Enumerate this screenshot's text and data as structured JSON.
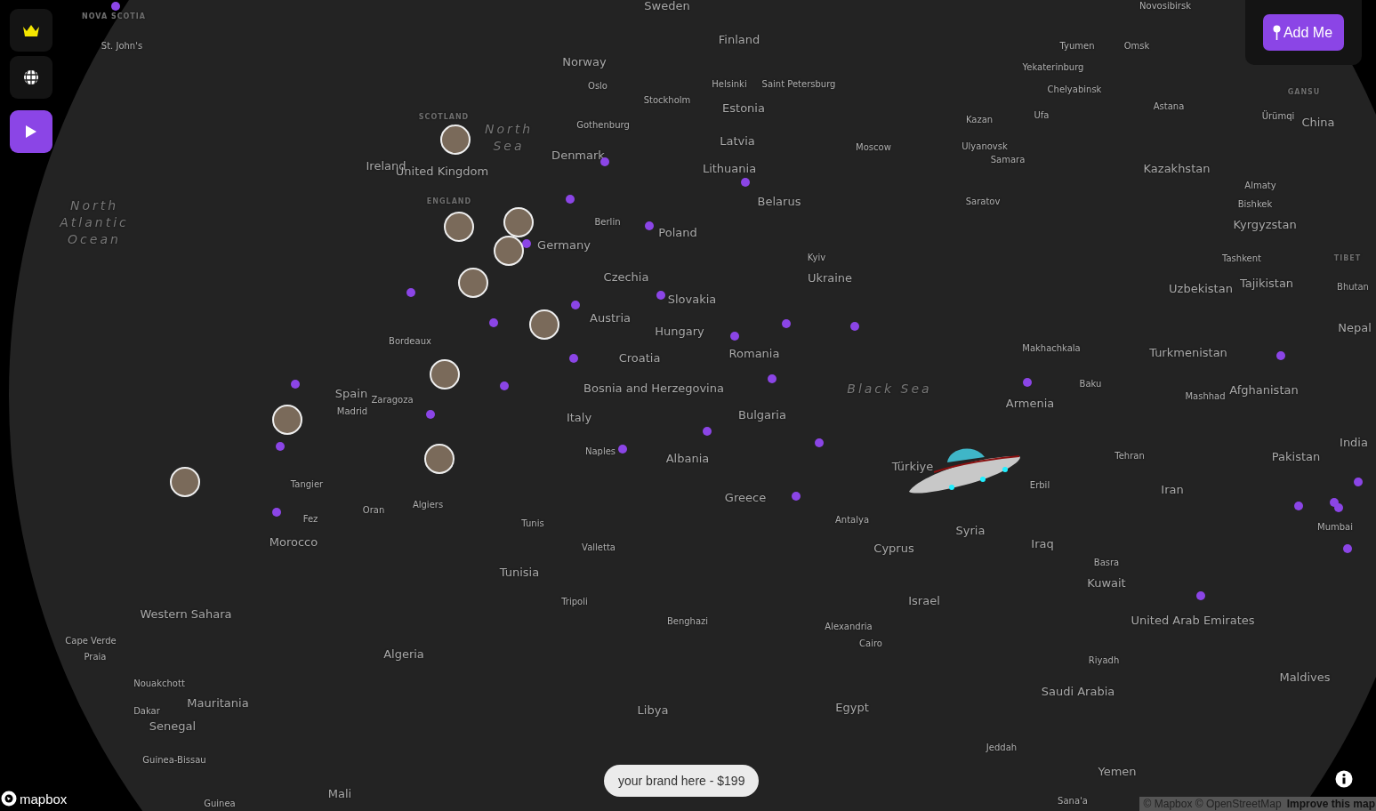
{
  "sidebar": {
    "buttons": [
      {
        "kind": "crown",
        "selected": false
      },
      {
        "kind": "globe",
        "selected": false
      },
      {
        "kind": "play",
        "selected": true
      }
    ]
  },
  "add_button": {
    "label": "Add Me"
  },
  "map_labels": [
    {
      "text": "Sweden",
      "kind": "country"
    },
    {
      "text": "Novosibirsk",
      "kind": "city"
    },
    {
      "text": "NOVA SCOTIA",
      "kind": "region"
    },
    {
      "text": "St. John's",
      "kind": "city"
    },
    {
      "text": "Finland",
      "kind": "country"
    },
    {
      "text": "Tyumen",
      "kind": "city"
    },
    {
      "text": "Omsk",
      "kind": "city"
    },
    {
      "text": "Norway",
      "kind": "country"
    },
    {
      "text": "Yekaterinburg",
      "kind": "city"
    },
    {
      "text": "Oslo",
      "kind": "city"
    },
    {
      "text": "Helsinki",
      "kind": "city"
    },
    {
      "text": "Saint Petersburg",
      "kind": "city"
    },
    {
      "text": "Chelyabinsk",
      "kind": "city"
    },
    {
      "text": "GANSU",
      "kind": "region"
    },
    {
      "text": "Stockholm",
      "kind": "city"
    },
    {
      "text": "Estonia",
      "kind": "country"
    },
    {
      "text": "Astana",
      "kind": "city"
    },
    {
      "text": "SCOTLAND",
      "kind": "region"
    },
    {
      "text": "Gothenburg",
      "kind": "city"
    },
    {
      "text": "Kazan",
      "kind": "city"
    },
    {
      "text": "Ufa",
      "kind": "city"
    },
    {
      "text": "Ürümqi",
      "kind": "city"
    },
    {
      "text": "China",
      "kind": "country"
    },
    {
      "text": "North Sea",
      "kind": "water"
    },
    {
      "text": "Latvia",
      "kind": "country"
    },
    {
      "text": "Moscow",
      "kind": "city"
    },
    {
      "text": "Ulyanovsk",
      "kind": "city"
    },
    {
      "text": "Denmark",
      "kind": "country"
    },
    {
      "text": "Samara",
      "kind": "city"
    },
    {
      "text": "Ireland",
      "kind": "country"
    },
    {
      "text": "United Kingdom",
      "kind": "country"
    },
    {
      "text": "Lithuania",
      "kind": "country"
    },
    {
      "text": "Kazakhstan",
      "kind": "country"
    },
    {
      "text": "Almaty",
      "kind": "city"
    },
    {
      "text": "North Atlantic Ocean",
      "kind": "water"
    },
    {
      "text": "ENGLAND",
      "kind": "region"
    },
    {
      "text": "Belarus",
      "kind": "country"
    },
    {
      "text": "Saratov",
      "kind": "city"
    },
    {
      "text": "Bishkek",
      "kind": "city"
    },
    {
      "text": "Berlin",
      "kind": "city"
    },
    {
      "text": "Poland",
      "kind": "country"
    },
    {
      "text": "Kyrgyzstan",
      "kind": "country"
    },
    {
      "text": "Germany",
      "kind": "country"
    },
    {
      "text": "Kyiv",
      "kind": "city"
    },
    {
      "text": "Tashkent",
      "kind": "city"
    },
    {
      "text": "TIBET",
      "kind": "region"
    },
    {
      "text": "Czechia",
      "kind": "country"
    },
    {
      "text": "Ukraine",
      "kind": "country"
    },
    {
      "text": "Uzbekistan",
      "kind": "country"
    },
    {
      "text": "Tajikistan",
      "kind": "country"
    },
    {
      "text": "Bhutan",
      "kind": "country"
    },
    {
      "text": "Slovakia",
      "kind": "country"
    },
    {
      "text": "Austria",
      "kind": "country"
    },
    {
      "text": "Hungary",
      "kind": "country"
    },
    {
      "text": "Nepal",
      "kind": "country"
    },
    {
      "text": "Bordeaux",
      "kind": "city"
    },
    {
      "text": "Romania",
      "kind": "country"
    },
    {
      "text": "Makhachkala",
      "kind": "city"
    },
    {
      "text": "Turkmenistan",
      "kind": "country"
    },
    {
      "text": "Croatia",
      "kind": "country"
    },
    {
      "text": "Spain",
      "kind": "country"
    },
    {
      "text": "Bosnia and Herzegovina",
      "kind": "country"
    },
    {
      "text": "Black Sea",
      "kind": "water"
    },
    {
      "text": "Baku",
      "kind": "city"
    },
    {
      "text": "Mashhad",
      "kind": "city"
    },
    {
      "text": "Afghanistan",
      "kind": "country"
    },
    {
      "text": "Zaragoza",
      "kind": "city"
    },
    {
      "text": "Armenia",
      "kind": "country"
    },
    {
      "text": "Madrid",
      "kind": "city"
    },
    {
      "text": "Italy",
      "kind": "country"
    },
    {
      "text": "Bulgaria",
      "kind": "country"
    },
    {
      "text": "India",
      "kind": "country"
    },
    {
      "text": "Naples",
      "kind": "city"
    },
    {
      "text": "Albania",
      "kind": "country"
    },
    {
      "text": "Tehran",
      "kind": "city"
    },
    {
      "text": "Pakistan",
      "kind": "country"
    },
    {
      "text": "Türkiye",
      "kind": "country"
    },
    {
      "text": "Tangier",
      "kind": "city"
    },
    {
      "text": "Erbil",
      "kind": "city"
    },
    {
      "text": "Iran",
      "kind": "country"
    },
    {
      "text": "Greece",
      "kind": "country"
    },
    {
      "text": "Oran",
      "kind": "city"
    },
    {
      "text": "Algiers",
      "kind": "city"
    },
    {
      "text": "Fez",
      "kind": "city"
    },
    {
      "text": "Tunis",
      "kind": "city"
    },
    {
      "text": "Antalya",
      "kind": "city"
    },
    {
      "text": "Syria",
      "kind": "country"
    },
    {
      "text": "Mumbai",
      "kind": "city"
    },
    {
      "text": "Morocco",
      "kind": "country"
    },
    {
      "text": "Valletta",
      "kind": "city"
    },
    {
      "text": "Cyprus",
      "kind": "country"
    },
    {
      "text": "Iraq",
      "kind": "country"
    },
    {
      "text": "Basra",
      "kind": "city"
    },
    {
      "text": "Tunisia",
      "kind": "country"
    },
    {
      "text": "Kuwait",
      "kind": "country"
    },
    {
      "text": "Tripoli",
      "kind": "city"
    },
    {
      "text": "Israel",
      "kind": "country"
    },
    {
      "text": "Western Sahara",
      "kind": "country"
    },
    {
      "text": "Benghazi",
      "kind": "city"
    },
    {
      "text": "United Arab Emirates",
      "kind": "country"
    },
    {
      "text": "Alexandria",
      "kind": "city"
    },
    {
      "text": "Cape Verde",
      "kind": "city"
    },
    {
      "text": "Cairo",
      "kind": "city"
    },
    {
      "text": "Praia",
      "kind": "city"
    },
    {
      "text": "Algeria",
      "kind": "country"
    },
    {
      "text": "Riyadh",
      "kind": "city"
    },
    {
      "text": "Maldives",
      "kind": "country"
    },
    {
      "text": "Nouakchott",
      "kind": "city"
    },
    {
      "text": "Saudi Arabia",
      "kind": "country"
    },
    {
      "text": "Dakar",
      "kind": "city"
    },
    {
      "text": "Mauritania",
      "kind": "country"
    },
    {
      "text": "Libya",
      "kind": "country"
    },
    {
      "text": "Egypt",
      "kind": "country"
    },
    {
      "text": "Senegal",
      "kind": "country"
    },
    {
      "text": "Jeddah",
      "kind": "city"
    },
    {
      "text": "Guinea-Bissau",
      "kind": "city"
    },
    {
      "text": "Yemen",
      "kind": "country"
    },
    {
      "text": "Mali",
      "kind": "country"
    },
    {
      "text": "Guinea",
      "kind": "city"
    },
    {
      "text": "Sana'a",
      "kind": "city"
    }
  ],
  "promo": {
    "label": "your brand here - $199"
  },
  "logo": {
    "text": "mapbox"
  },
  "attribution": {
    "text": "© Mapbox © OpenStreetMap",
    "link": "Improve this map"
  }
}
